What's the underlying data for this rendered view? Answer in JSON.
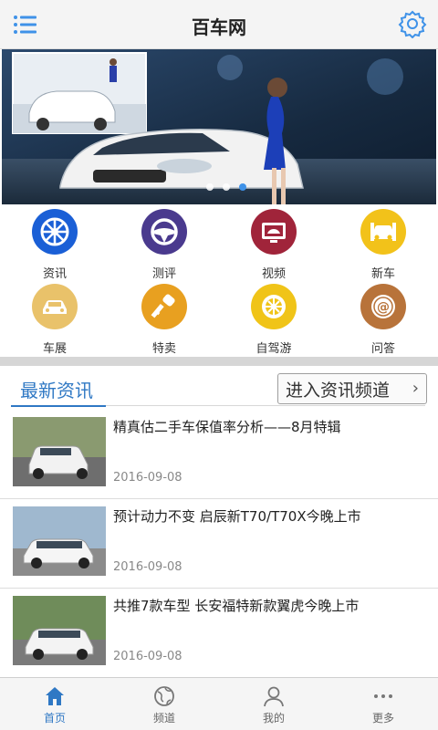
{
  "header": {
    "title": "百车网",
    "menu_icon": "menu-icon",
    "settings_icon": "gear-icon"
  },
  "banner": {
    "slides_count": 3,
    "active_slide": 3
  },
  "categories": [
    {
      "label": "资讯",
      "icon": "wheel-icon",
      "color": "#1a5fd6"
    },
    {
      "label": "测评",
      "icon": "steering-wheel-icon",
      "color": "#4a3a8e"
    },
    {
      "label": "视频",
      "icon": "video-car-icon",
      "color": "#a0243a"
    },
    {
      "label": "新车",
      "icon": "new-car-icon",
      "color": "#f2c21a"
    },
    {
      "label": "车展",
      "icon": "car-show-icon",
      "color": "#e9c26a"
    },
    {
      "label": "特卖",
      "icon": "key-icon",
      "color": "#e8a020"
    },
    {
      "label": "自驾游",
      "icon": "rim-icon",
      "color": "#f0c418"
    },
    {
      "label": "问答",
      "icon": "at-icon",
      "color": "#b8733a"
    }
  ],
  "section": {
    "title": "最新资讯",
    "channel_button": "进入资讯频道",
    "channel_arrow": "›"
  },
  "news": [
    {
      "headline": "精真估二手车保值率分析——8月特辑",
      "date": "2016-09-08"
    },
    {
      "headline": "预计动力不变 启辰新T70/T70X今晚上市",
      "date": "2016-09-08"
    },
    {
      "headline": "共推7款车型 长安福特新款翼虎今晚上市",
      "date": "2016-09-08"
    }
  ],
  "tabbar": {
    "tabs": [
      {
        "label": "首页",
        "icon": "home-icon"
      },
      {
        "label": "频道",
        "icon": "globe-icon"
      },
      {
        "label": "我的",
        "icon": "user-icon"
      },
      {
        "label": "更多",
        "icon": "more-dots-icon"
      }
    ],
    "active_index": 0
  },
  "colors": {
    "accent": "#2f78c4",
    "header_bg": "#f4f4f4"
  }
}
